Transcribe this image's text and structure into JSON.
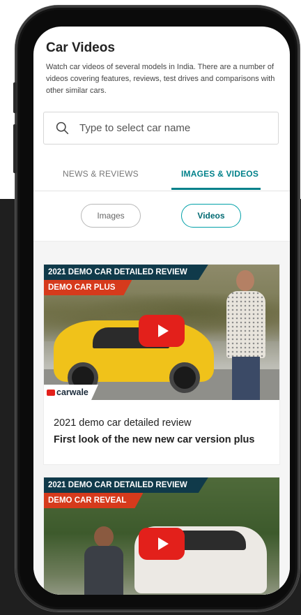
{
  "page": {
    "title": "Car Videos",
    "description": "Watch car videos of several models in India. There are a number of videos covering features, reviews, test drives and comparisons with other similar cars."
  },
  "search": {
    "placeholder": "Type to select car name",
    "icon": "search-icon"
  },
  "tabs": [
    {
      "label": "NEWS & REVIEWS",
      "active": false
    },
    {
      "label": "IMAGES & VIDEOS",
      "active": true
    }
  ],
  "filters": [
    {
      "label": "Images",
      "active": false
    },
    {
      "label": "Videos",
      "active": true
    }
  ],
  "videos": [
    {
      "banner_top": "2021 DEMO CAR DETAILED REVIEW",
      "banner_tag": "DEMO CAR PLUS",
      "logo_text": "carwale",
      "title": "2021 demo car detailed review",
      "subtitle": "First look of the new new car version plus"
    },
    {
      "banner_top": "2021 DEMO CAR DETAILED REVIEW",
      "banner_tag": "DEMO CAR REVEAL"
    }
  ],
  "colors": {
    "accent": "#00818a",
    "banner_dark": "#103a4a",
    "banner_red": "#d63a1c",
    "play_red": "#e3201b"
  }
}
